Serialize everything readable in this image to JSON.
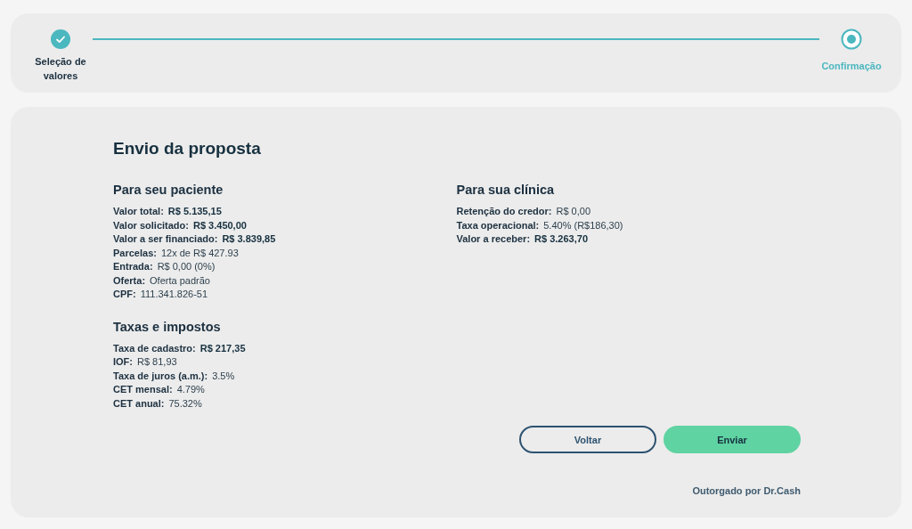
{
  "stepper": {
    "steps": [
      {
        "label": "Seleção de valores",
        "completed": true
      },
      {
        "label": "Confirmação",
        "completed": false
      }
    ]
  },
  "title": "Envio da proposta",
  "left_column": [
    {
      "heading": "Para seu paciente",
      "rows": [
        {
          "label": "Valor total:",
          "value": "R$ 5.135,15",
          "bold": true
        },
        {
          "label": "Valor solicitado:",
          "value": "R$ 3.450,00",
          "bold": true
        },
        {
          "label": "Valor a ser financiado:",
          "value": "R$ 3.839,85",
          "bold": true
        },
        {
          "label": "Parcelas:",
          "value": "12x de R$ 427.93",
          "bold": false
        },
        {
          "label": "Entrada:",
          "value": "R$ 0,00 (0%)",
          "bold": false
        },
        {
          "label": "Oferta:",
          "value": "Oferta padrão",
          "bold": false
        },
        {
          "label": "CPF:",
          "value": "111.341.826-51",
          "bold": false
        }
      ]
    },
    {
      "heading": "Taxas e impostos",
      "rows": [
        {
          "label": "Taxa de cadastro:",
          "value": "R$ 217,35",
          "bold": true
        },
        {
          "label": "IOF:",
          "value": "R$ 81,93",
          "bold": false
        },
        {
          "label": "Taxa de juros (a.m.):",
          "value": "3.5%",
          "bold": false
        },
        {
          "label": "CET mensal:",
          "value": "4.79%",
          "bold": false
        },
        {
          "label": "CET anual:",
          "value": "75.32%",
          "bold": false
        }
      ]
    }
  ],
  "right_column": [
    {
      "heading": "Para sua clínica",
      "rows": [
        {
          "label": "Retenção do credor:",
          "value": "R$ 0,00",
          "bold": false
        },
        {
          "label": "Taxa operacional:",
          "value": "5.40% (R$186,30)",
          "bold": false
        },
        {
          "label": "Valor a receber:",
          "value": "R$ 3.263,70",
          "bold": true
        }
      ]
    }
  ],
  "buttons": [
    {
      "label": "Voltar",
      "kind": "outline"
    },
    {
      "label": "Enviar",
      "kind": "primary"
    }
  ],
  "footer": "Outorgado por Dr.Cash"
}
